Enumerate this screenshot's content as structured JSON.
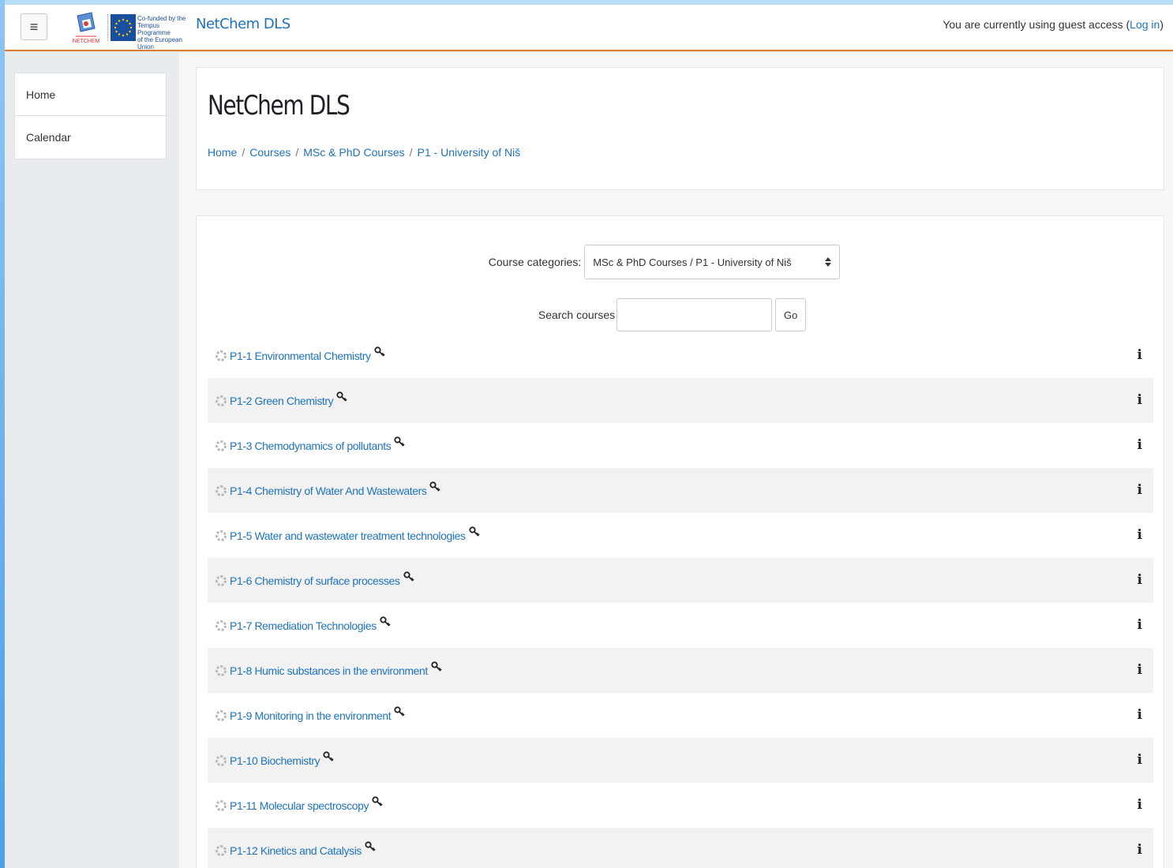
{
  "navbar": {
    "menu_icon": "hamburger-icon",
    "logo_text": "NETCHEM",
    "eu_lines": [
      "Co-funded by the",
      "Tempus Programme",
      "of the European Union"
    ],
    "brand": "NetChem DLS",
    "guest_text": "You are currently using guest access (",
    "login_label": "Log in",
    "guest_close": ")"
  },
  "sidebar": {
    "items": [
      {
        "label": "Home"
      },
      {
        "label": "Calendar"
      }
    ]
  },
  "header": {
    "title": "NetChem DLS",
    "breadcrumb": [
      "Home",
      "Courses",
      "MSc & PhD Courses",
      "P1 - University of Niš"
    ],
    "separator": "/"
  },
  "filters": {
    "category_label": "Course categories:",
    "category_value": "MSc & PhD Courses / P1 - University of Niš",
    "search_label": "Search courses",
    "search_placeholder": "",
    "go_label": "Go"
  },
  "courses": [
    {
      "name": "P1-1 Environmental Chemistry"
    },
    {
      "name": "P1-2 Green Chemistry"
    },
    {
      "name": "P1-3 Chemodynamics of pollutants"
    },
    {
      "name": "P1-4 Chemistry of Water And Wastewaters"
    },
    {
      "name": "P1-5 Water and wastewater treatment technologies"
    },
    {
      "name": "P1-6 Chemistry of surface processes"
    },
    {
      "name": "P1-7 Remediation Technologies"
    },
    {
      "name": "P1-8 Humic substances in the environment"
    },
    {
      "name": "P1-9 Monitoring in the environment"
    },
    {
      "name": "P1-10 Biochemistry"
    },
    {
      "name": "P1-11 Molecular spectroscopy"
    },
    {
      "name": "P1-12 Kinetics and Catalysis"
    }
  ],
  "info_glyph": "i",
  "colors": {
    "link": "#1e73be",
    "navbar_border": "#e07a2e",
    "row_alt": "#f2f2f2"
  }
}
